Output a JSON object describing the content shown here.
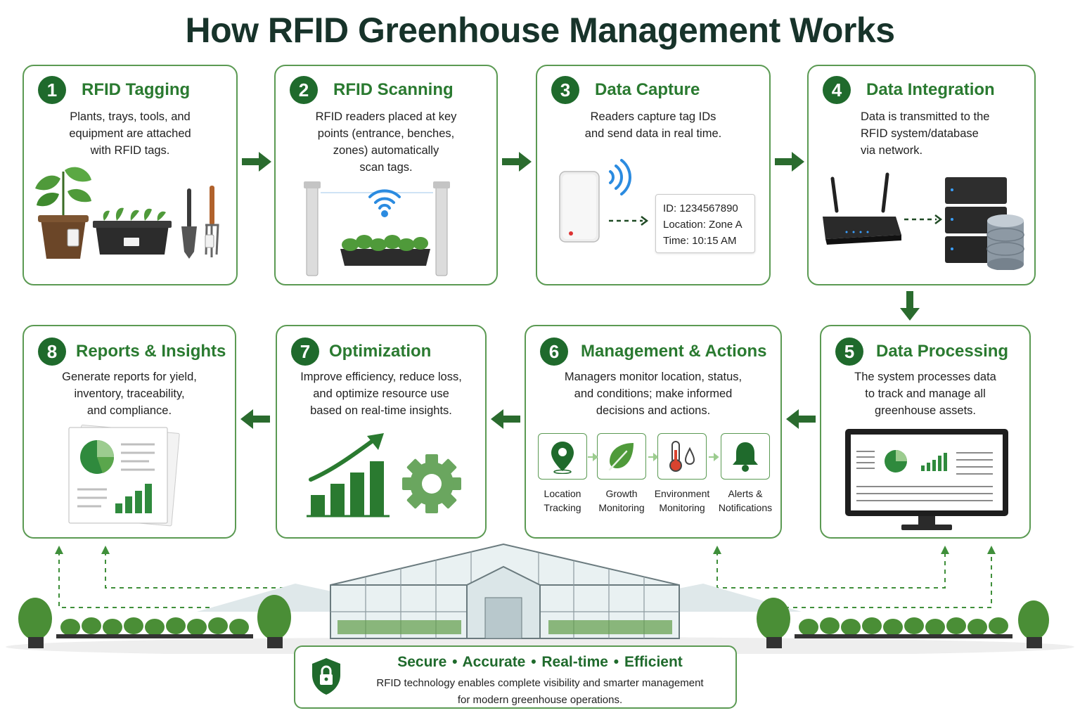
{
  "title": "How RFID Greenhouse Management Works",
  "colors": {
    "primary": "#1f6a2c",
    "heading": "#2a7a30",
    "border": "#5b9a53",
    "light_green": "#6aa65f"
  },
  "steps": [
    {
      "number": "1",
      "title": "RFID Tagging",
      "description": "Plants, trays, tools, and\nequipment are attached\nwith RFID tags.",
      "icons": [
        "potted-plant-icon",
        "seedling-tray-icon",
        "garden-tools-icon"
      ]
    },
    {
      "number": "2",
      "title": "RFID Scanning",
      "description": "RFID readers placed at key\npoints (entrance, benches,\nzones) automatically\nscan tags.",
      "icons": [
        "rfid-gate-icon",
        "wifi-signal-icon"
      ]
    },
    {
      "number": "3",
      "title": "Data Capture",
      "description": "Readers capture tag IDs\nand send data in real time.",
      "icons": [
        "rfid-reader-icon",
        "signal-waves-icon"
      ]
    },
    {
      "number": "4",
      "title": "Data Integration",
      "description": "Data is transmitted to the\nRFID system/database\nvia network.",
      "icons": [
        "router-icon",
        "server-icon",
        "database-icon"
      ]
    },
    {
      "number": "5",
      "title": "Data Processing",
      "description": "The system processes data\nto track and manage all\ngreenhouse assets.",
      "icons": [
        "dashboard-monitor-icon"
      ]
    },
    {
      "number": "6",
      "title": "Management & Actions",
      "description": "Managers monitor location, status,\nand conditions; make informed\ndecisions and actions.",
      "icons": []
    },
    {
      "number": "7",
      "title": "Optimization",
      "description": "Improve efficiency, reduce loss,\nand optimize resource use\nbased on real-time insights.",
      "icons": [
        "growth-chart-icon",
        "gear-icon"
      ]
    },
    {
      "number": "8",
      "title": "Reports & Insights",
      "description": "Generate reports for yield,\ninventory, traceability,\nand compliance.",
      "icons": [
        "report-document-icon"
      ]
    }
  ],
  "data_capture_box": {
    "id": "ID: 1234567890",
    "location": "Location: Zone A",
    "time": "Time: 10:15 AM"
  },
  "management_features": [
    {
      "label": "Location\nTracking",
      "icon": "location-pin-icon"
    },
    {
      "label": "Growth\nMonitoring",
      "icon": "leaf-icon"
    },
    {
      "label": "Environment\nMonitoring",
      "icon": "thermometer-icon"
    },
    {
      "label": "Alerts &\nNotifications",
      "icon": "bell-icon"
    }
  ],
  "footer": {
    "headline": "Secure • Accurate  •  Real-time  • Efficient",
    "description": "RFID technology enables complete visibility and smarter management\nfor modern greenhouse operations.",
    "icon": "lock-shield-icon"
  }
}
